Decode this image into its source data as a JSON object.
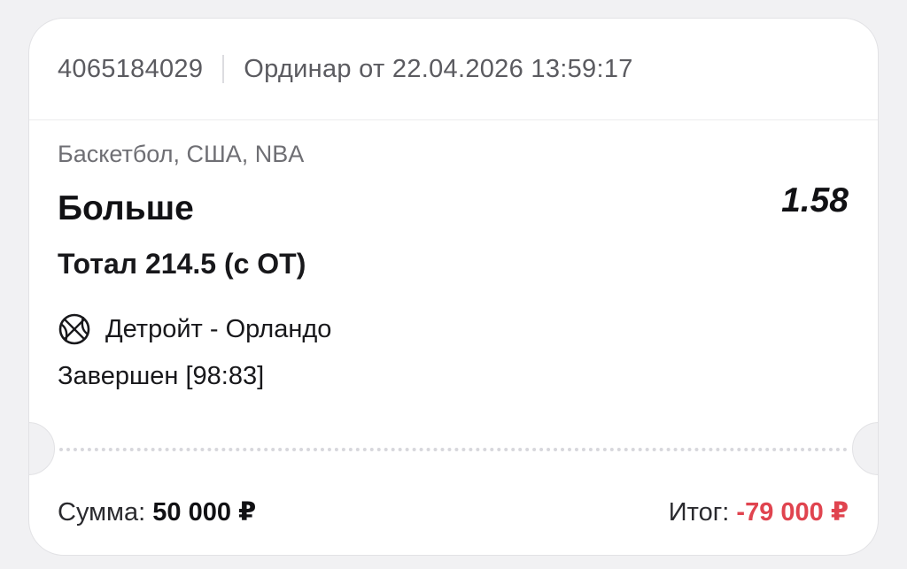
{
  "colors": {
    "background": "#f1f1f3",
    "card": "#ffffff",
    "negative_result": "#e0444f",
    "primary_text": "#111114",
    "secondary_text": "#6f6f74"
  },
  "bet": {
    "id": "4065184029",
    "type_and_date": "Ординар от 22.04.2026 13:59:17",
    "league": "Баскетбол, США, NBA",
    "outcome": "Больше",
    "odds": "1.58",
    "market": "Тотал 214.5 (с ОТ)",
    "sport_icon": "basketball-icon",
    "match": "Детройт - Орландо",
    "status": "Завершен [98:83]"
  },
  "footer": {
    "stake_label": "Сумма:",
    "stake_value": "50 000 ₽",
    "result_label": "Итог:",
    "result_value": "-79 000 ₽"
  }
}
